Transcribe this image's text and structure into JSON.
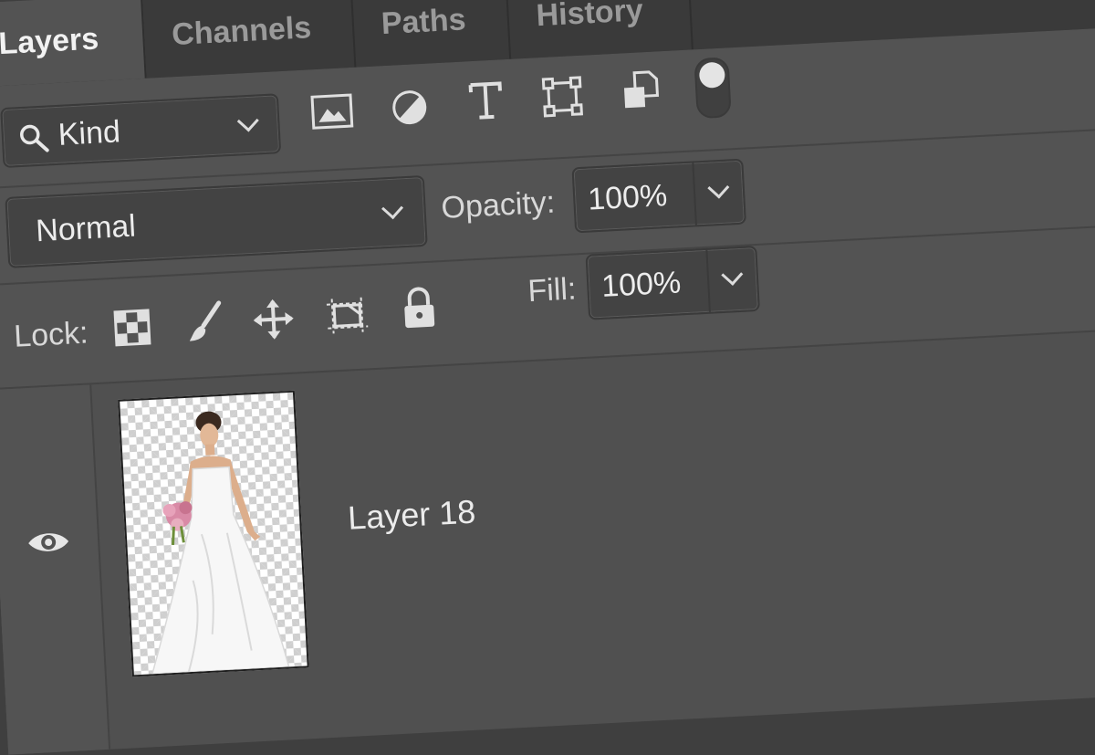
{
  "tabs": [
    {
      "label": "Layers",
      "active": true
    },
    {
      "label": "Channels",
      "active": false
    },
    {
      "label": "Paths",
      "active": false
    },
    {
      "label": "History",
      "active": false
    }
  ],
  "filter": {
    "kind_label": "Kind",
    "icons": [
      "search-icon",
      "image-filter-icon",
      "adjustment-filter-icon",
      "type-filter-icon",
      "shape-filter-icon",
      "smart-object-filter-icon",
      "filter-toggle"
    ]
  },
  "blend": {
    "mode": "Normal",
    "opacity_label": "Opacity:",
    "opacity_value": "100%"
  },
  "lock": {
    "label": "Lock:",
    "icons": [
      "lock-transparent-pixels-icon",
      "lock-image-pixels-icon",
      "lock-position-icon",
      "lock-artboard-icon",
      "lock-all-icon"
    ],
    "fill_label": "Fill:",
    "fill_value": "100%"
  },
  "layers": [
    {
      "name": "Layer 18",
      "visible": true
    }
  ],
  "colors": {
    "panel": "#535353",
    "tabbar": "#3a3a3a",
    "field": "#434343",
    "text": "#e6e6e6"
  }
}
